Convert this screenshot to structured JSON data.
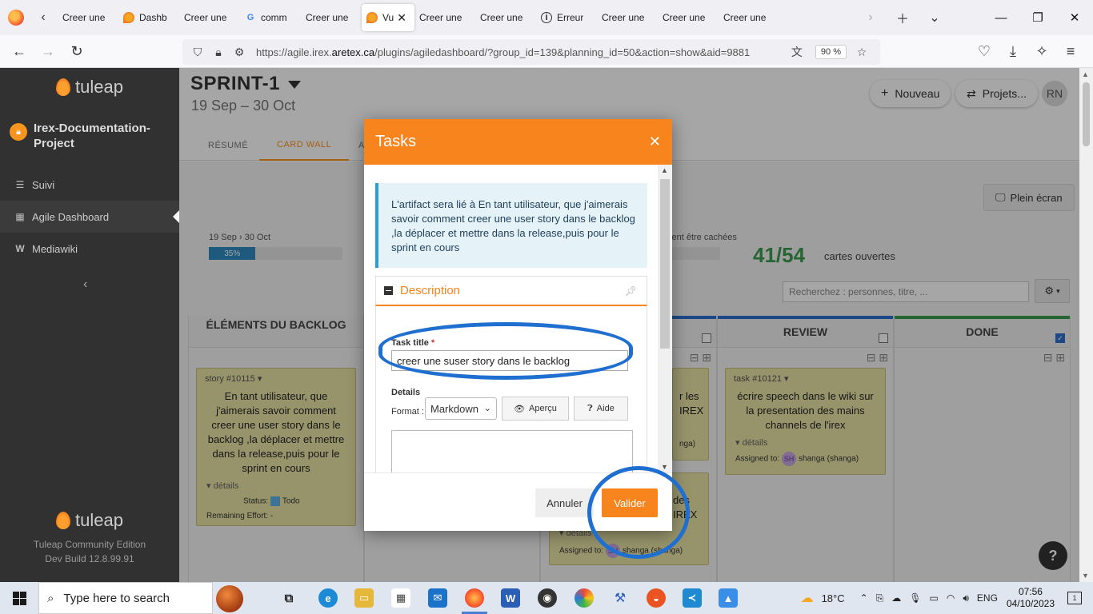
{
  "browser": {
    "tabs": [
      {
        "label": "Creer une",
        "icon": "tuleap-favicon"
      },
      {
        "label": "Dashb",
        "icon": "tuleap-favicon"
      },
      {
        "label": "Creer une",
        "icon": "tuleap-favicon"
      },
      {
        "label": "comm",
        "icon": "google-favicon"
      },
      {
        "label": "Creer une",
        "icon": "tuleap-favicon"
      },
      {
        "label": "Vu",
        "icon": "tuleap-favicon",
        "active": true
      },
      {
        "label": "Creer une",
        "icon": "tuleap-favicon"
      },
      {
        "label": "Creer une",
        "icon": "tuleap-favicon"
      },
      {
        "label": "Creer une",
        "icon": "tuleap-favicon"
      },
      {
        "label": "Erreur",
        "icon": "info-favicon"
      },
      {
        "label": "Creer une",
        "icon": "tuleap-favicon"
      },
      {
        "label": "Creer une",
        "icon": "tuleap-favicon"
      },
      {
        "label": "Creer une",
        "icon": "tuleap-favicon"
      }
    ],
    "url_prefix": "https://agile.irex.",
    "url_domain": "aretex.ca",
    "url_rest": "/plugins/agiledashboard/?group_id=139&planning_id=50&action=show&aid=9881",
    "zoom": "90 %"
  },
  "sidebar": {
    "brand": "tuleap",
    "project_name": "Irex-Documentation-Project",
    "items": [
      {
        "label": "Suivi",
        "icon": "list-icon"
      },
      {
        "label": "Agile Dashboard",
        "icon": "table-icon",
        "active": true
      },
      {
        "label": "Mediawiki",
        "icon": "wiki-icon"
      }
    ],
    "footer_brand": "tuleap",
    "footer_edition": "Tuleap Community Edition",
    "footer_build": "Dev Build 12.8.99.91"
  },
  "header": {
    "sprint_title": "SPRINT-1",
    "sprint_dates": "19 Sep – 30 Oct",
    "new_label": "Nouveau",
    "projects_label": "Projets...",
    "avatar_initials": "RN"
  },
  "agile_tabs": [
    {
      "label": "RÉSUMÉ"
    },
    {
      "label": "CARD WALL",
      "active": true
    },
    {
      "label": "A"
    }
  ],
  "cardwall": {
    "fullscreen_label": "Plein écran",
    "mini_dates": "19 Sep › 30 Oct",
    "progress_pct": 35,
    "progress_label": "35%",
    "hidden_note": "vent être cachées",
    "open_count": "41/54",
    "open_label": "cartes ouvertes",
    "search_placeholder": "Recherchez : personnes, titre, ...",
    "backlog_header": "ÉLÉMENTS DU BACKLOG",
    "review_header": "REVIEW",
    "done_header": "DONE",
    "story_card": {
      "id": "story #10115",
      "text": "En tant utilisateur, que j'aimerais savoir comment creer une user story dans le backlog ,la déplacer et mettre dans la release,puis pour le sprint en cours",
      "details": "détails",
      "status_label": "Status:",
      "status_value": "Todo",
      "remaining": "Remaining Effort: -"
    },
    "review_card": {
      "id": "task #10121",
      "text": "écrire speech dans le wiki sur la presentation des mains channels de l'irex",
      "details": "détails",
      "assigned_label": "Assigned to:",
      "assignee_initials": "SH",
      "assignee": "shanga (shanga)"
    },
    "partial_card_1": {
      "line1": "r les",
      "line2": "IREX",
      "line3": "nga)"
    },
    "partial_card_2": {
      "line1": "des",
      "line2": "IREX",
      "details": "détails",
      "assigned_label": "Assigned to:",
      "assignee_initials": "SH",
      "assignee": "shanga (shanga)"
    }
  },
  "modal": {
    "title": "Tasks",
    "info": "L'artifact sera lié à En tant utilisateur, que j'aimerais savoir comment creer une user story dans le backlog ,la déplacer et mettre dans la release,puis pour le sprint en cours",
    "section_label": "Description",
    "task_title_label": "Task title",
    "task_title_required": "*",
    "task_title_value": "creer une suser story dans le backlog",
    "details_label": "Details",
    "format_label": "Format :",
    "format_value": "Markdown",
    "preview_label": "Aperçu",
    "help_label": "Aide",
    "cancel_label": "Annuler",
    "submit_label": "Valider"
  },
  "taskbar": {
    "search_placeholder": "Type here to search",
    "weather": "18°C",
    "language": "ENG",
    "time": "07:56",
    "date": "04/10/2023",
    "notifications": "1"
  },
  "colors": {
    "accent": "#f7841d",
    "annotation": "#1f6fd1",
    "progress": "#2e8bc0",
    "count_green": "#3b9c4d"
  }
}
